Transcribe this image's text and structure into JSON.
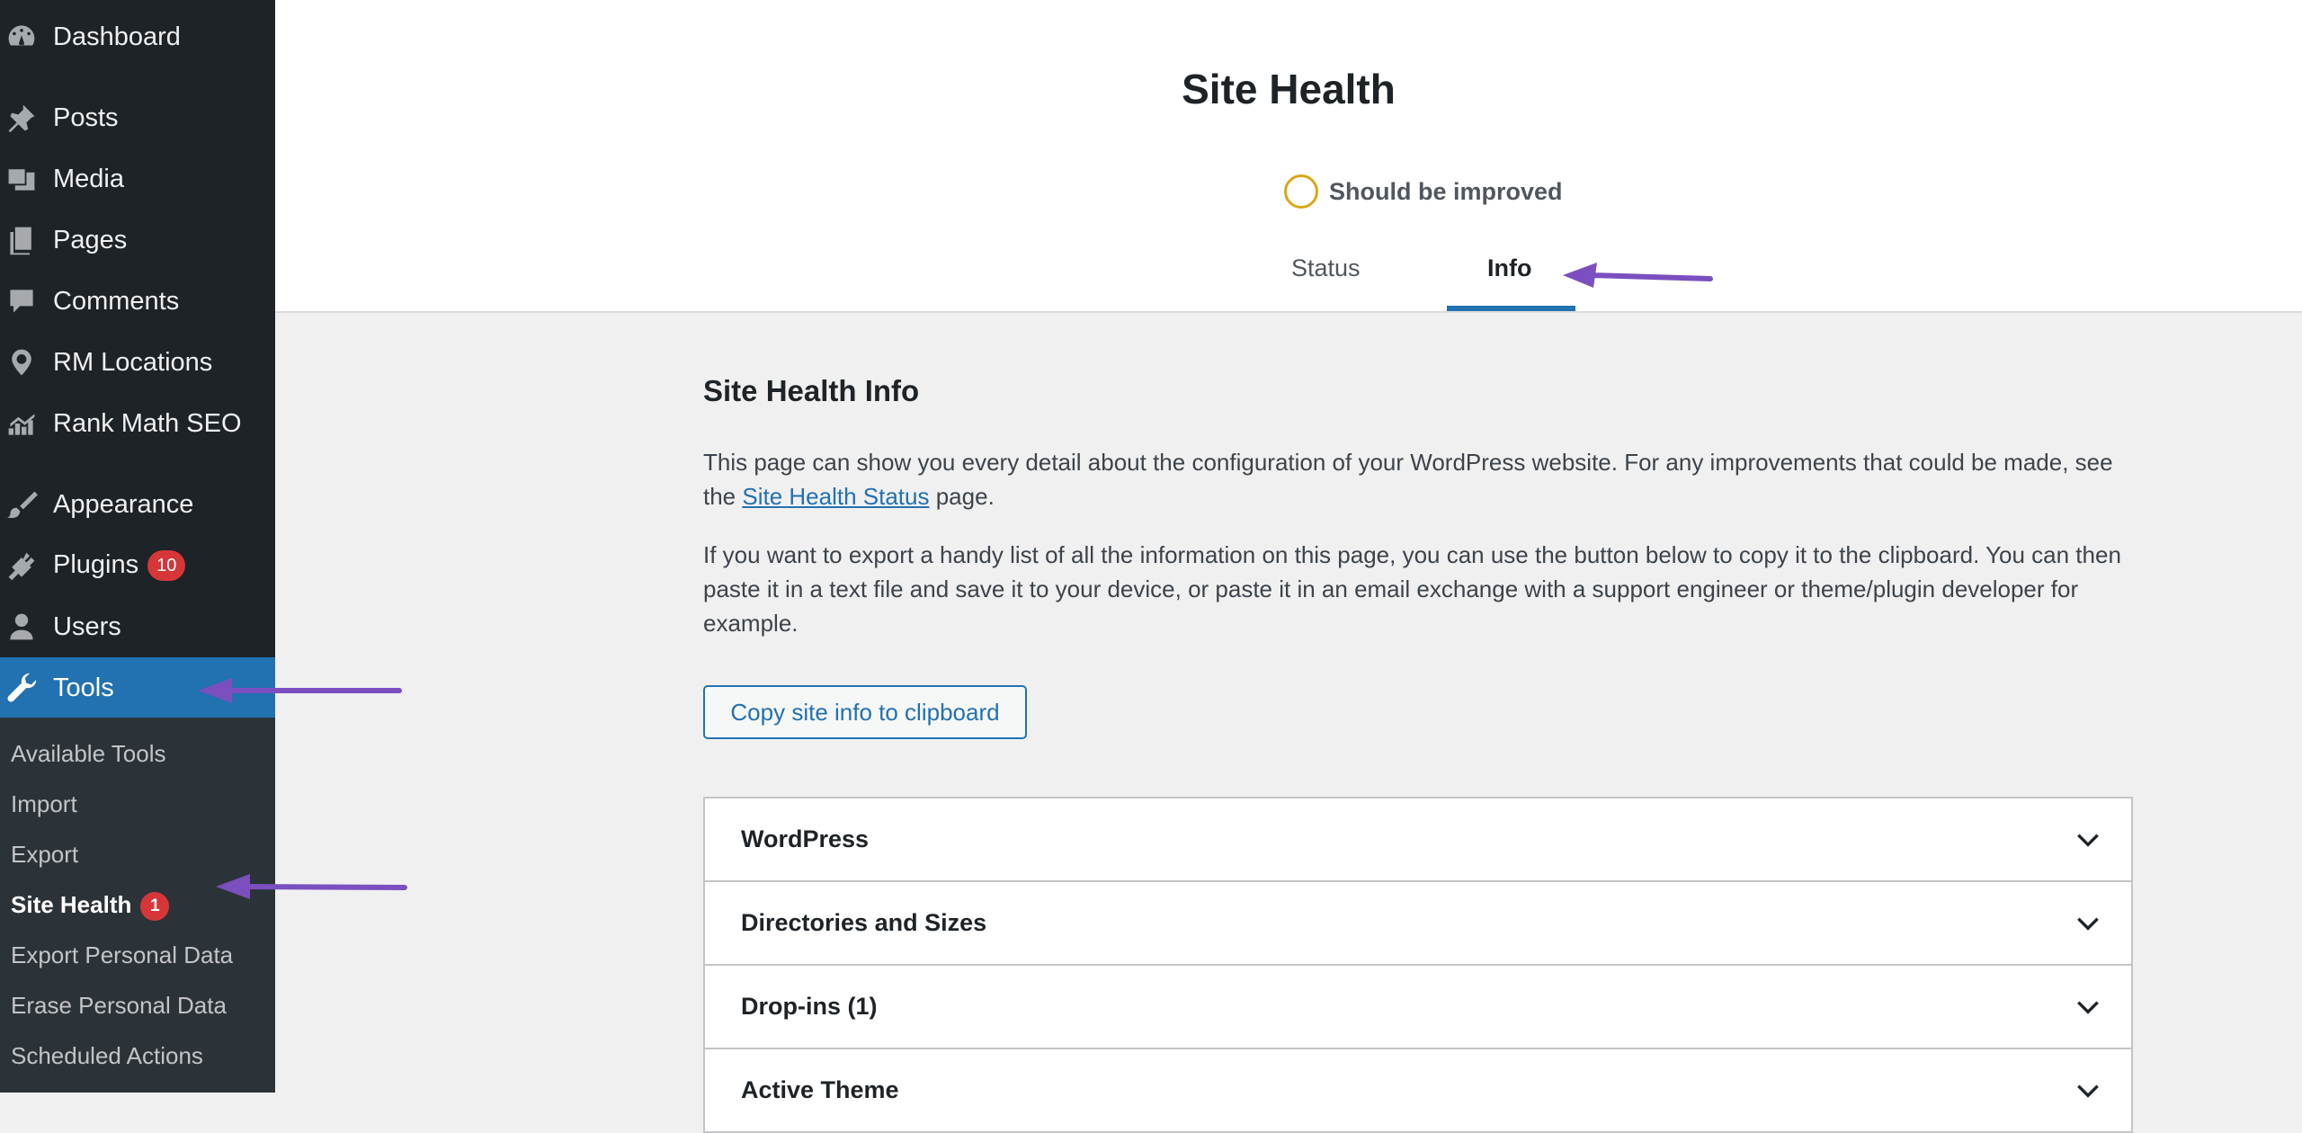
{
  "sidebar": {
    "items": [
      {
        "label": "Dashboard",
        "icon": "dashboard-icon"
      },
      {
        "label": "Posts",
        "icon": "pin-icon"
      },
      {
        "label": "Media",
        "icon": "media-icon"
      },
      {
        "label": "Pages",
        "icon": "pages-icon"
      },
      {
        "label": "Comments",
        "icon": "comment-icon"
      },
      {
        "label": "RM Locations",
        "icon": "location-icon"
      },
      {
        "label": "Rank Math SEO",
        "icon": "chart-icon"
      },
      {
        "label": "Appearance",
        "icon": "brush-icon"
      },
      {
        "label": "Plugins",
        "icon": "plug-icon",
        "badge": "10"
      },
      {
        "label": "Users",
        "icon": "user-icon"
      },
      {
        "label": "Tools",
        "icon": "wrench-icon",
        "active": true
      }
    ],
    "submenu": [
      {
        "label": "Available Tools"
      },
      {
        "label": "Import"
      },
      {
        "label": "Export"
      },
      {
        "label": "Site Health",
        "badge": "1",
        "current": true
      },
      {
        "label": "Export Personal Data"
      },
      {
        "label": "Erase Personal Data"
      },
      {
        "label": "Scheduled Actions"
      }
    ]
  },
  "header": {
    "title": "Site Health",
    "status": "Should be improved",
    "tabs": [
      {
        "label": "Status"
      },
      {
        "label": "Info",
        "active": true
      }
    ]
  },
  "main": {
    "heading": "Site Health Info",
    "para1_before": "This page can show you every detail about the configuration of your WordPress website. For any improvements that could be made, see the ",
    "para1_link": "Site Health Status",
    "para1_after": " page.",
    "para2": "If you want to export a handy list of all the information on this page, you can use the button below to copy it to the clipboard. You can then paste it in a text file and save it to your device, or paste it in an email exchange with a support engineer or theme/plugin developer for example.",
    "copy_button": "Copy site info to clipboard",
    "sections": [
      {
        "title": "WordPress"
      },
      {
        "title": "Directories and Sizes"
      },
      {
        "title": "Drop-ins (1)"
      },
      {
        "title": "Active Theme"
      }
    ]
  },
  "colors": {
    "sidebar_bg": "#1d2327",
    "active_blue": "#2271b1",
    "badge_red": "#d63638",
    "status_ring": "#dba617",
    "annotation_arrow": "#7b4fbf"
  }
}
